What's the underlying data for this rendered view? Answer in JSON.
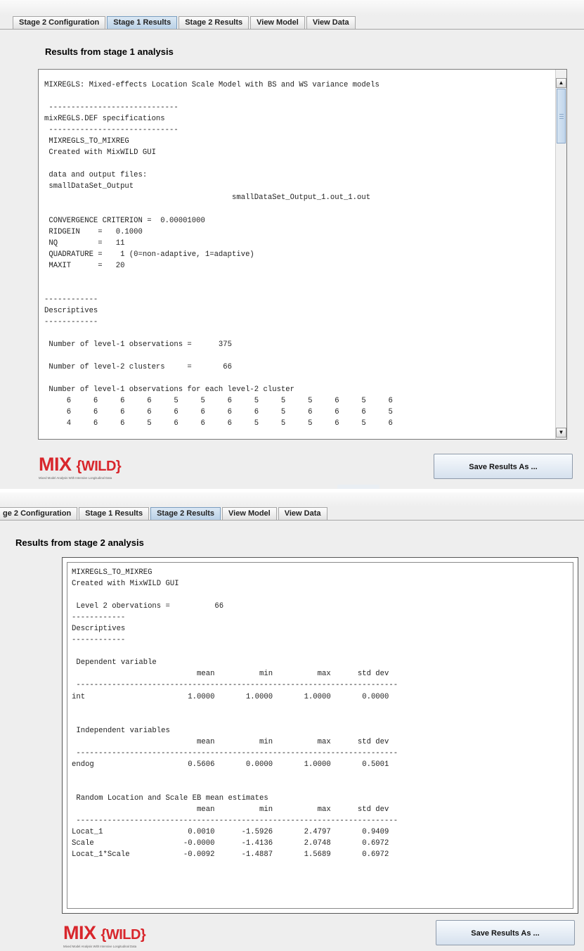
{
  "top_panel": {
    "tabs": [
      "Stage 2 Configuration",
      "Stage 1 Results",
      "Stage 2 Results",
      "View Model",
      "View Data"
    ],
    "active_tab": "Stage 1 Results",
    "heading": "Results from stage 1 analysis",
    "output_text": "MIXREGLS: Mixed-effects Location Scale Model with BS and WS variance models\n\n -----------------------------\nmixREGLS.DEF specifications\n -----------------------------\n MIXREGLS_TO_MIXREG\n Created with MixWILD GUI\n\n data and output files:\n smallDataSet_Output\n                                          smallDataSet_Output_1.out_1.out\n\n CONVERGENCE CRITERION =  0.00001000\n RIDGEIN    =   0.1000\n NQ         =   11\n QUADRATURE =    1 (0=non-adaptive, 1=adaptive)\n MAXIT      =   20\n\n\n------------\nDescriptives\n------------\n\n Number of level-1 observations =      375\n\n Number of level-2 clusters     =       66\n\n Number of level-1 observations for each level-2 cluster\n     6     6     6     6     5     5     6     5     5     5     6     5     6\n     6     6     6     6     6     6     6     6     5     6     6     6     5\n     4     6     6     5     6     6     6     5     5     5     6     5     6",
    "logo": {
      "main": "MIX",
      "brace_text": "{WILD}",
      "subtitle": "Mixed Model Analysis With Intensive Longitudinal Data"
    },
    "save_button": "Save Results As ..."
  },
  "bottom_panel": {
    "tabs": [
      "ge 2 Configuration",
      "Stage 1 Results",
      "Stage 2 Results",
      "View Model",
      "View Data"
    ],
    "active_tab": "Stage 2 Results",
    "heading": "Results from stage 2 analysis",
    "output_text": "MIXREGLS_TO_MIXREG\nCreated with MixWILD GUI\n\n Level 2 obervations =          66\n------------\nDescriptives\n------------\n\n Dependent variable\n                            mean          min          max      std dev\n ------------------------------------------------------------------------\nint                       1.0000       1.0000       1.0000       0.0000\n\n\n Independent variables\n                            mean          min          max      std dev\n ------------------------------------------------------------------------\nendog                     0.5606       0.0000       1.0000       0.5001\n\n\n Random Location and Scale EB mean estimates\n                            mean          min          max      std dev\n ------------------------------------------------------------------------\nLocat_1                   0.0010      -1.5926       2.4797       0.9409\nScale                    -0.0000      -1.4136       2.0748       0.6972\nLocat_1*Scale            -0.0092      -1.4887       1.5689       0.6972",
    "logo": {
      "main": "MIX",
      "brace_text": "{WILD}",
      "subtitle": "Mixed Model Analysis With Intensive Longitudinal Data"
    },
    "save_button": "Save Results As ..."
  },
  "scrollbar": {
    "up_icon": "arrow-up-icon",
    "down_icon": "arrow-down-icon"
  },
  "colors": {
    "logo_red": "#d8262c",
    "active_tab": "#b8d0e6",
    "panel_bg": "#eeeeee"
  }
}
